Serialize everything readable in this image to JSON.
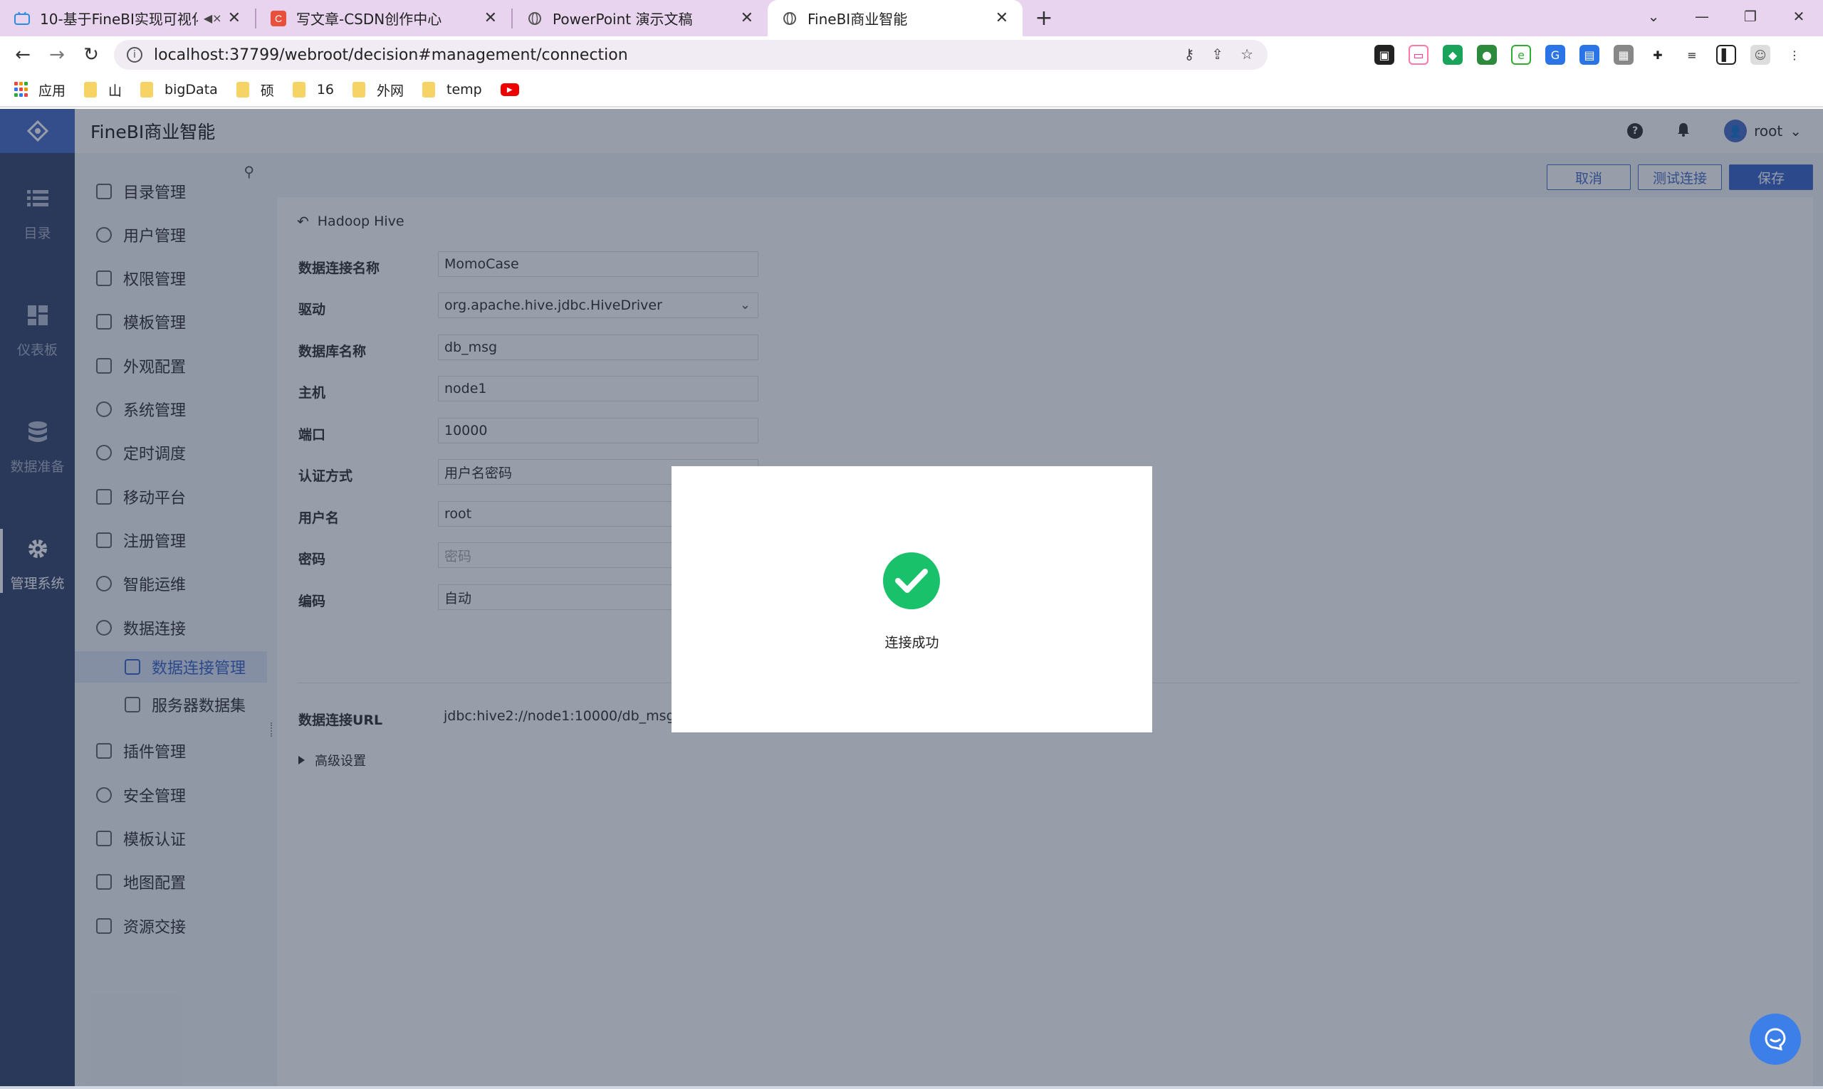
{
  "browser": {
    "tabs": [
      {
        "title": "10-基于FineBI实现可视化报",
        "icon": "bilibili-icon",
        "muted": true,
        "active": false
      },
      {
        "title": "写文章-CSDN创作中心",
        "icon": "csdn-icon",
        "active": false
      },
      {
        "title": "PowerPoint 演示文稿",
        "icon": "globe-icon",
        "active": false
      },
      {
        "title": "FineBI商业智能",
        "icon": "globe-icon",
        "active": true
      }
    ],
    "url": "localhost:37799/webroot/decision#management/connection",
    "bookmarks": [
      {
        "label": "应用",
        "type": "apps"
      },
      {
        "label": "山",
        "type": "folder"
      },
      {
        "label": "bigData",
        "type": "folder"
      },
      {
        "label": "硕",
        "type": "folder"
      },
      {
        "label": "16",
        "type": "folder"
      },
      {
        "label": "外网",
        "type": "folder"
      },
      {
        "label": "temp",
        "type": "folder"
      },
      {
        "label": "",
        "type": "youtube"
      }
    ]
  },
  "app": {
    "title": "FineBI商业智能",
    "user": "root",
    "rail": [
      {
        "label": "目录",
        "icon": "list-icon"
      },
      {
        "label": "仪表板",
        "icon": "dashboard-icon"
      },
      {
        "label": "数据准备",
        "icon": "database-icon"
      },
      {
        "label": "管理系统",
        "icon": "gear-icon",
        "active": true
      }
    ],
    "menu": [
      {
        "label": "目录管理"
      },
      {
        "label": "用户管理"
      },
      {
        "label": "权限管理"
      },
      {
        "label": "模板管理"
      },
      {
        "label": "外观配置"
      },
      {
        "label": "系统管理"
      },
      {
        "label": "定时调度"
      },
      {
        "label": "移动平台"
      },
      {
        "label": "注册管理"
      },
      {
        "label": "智能运维"
      },
      {
        "label": "数据连接"
      },
      {
        "label": "数据连接管理",
        "sub": true,
        "active": true
      },
      {
        "label": "服务器数据集",
        "sub": true
      },
      {
        "label": "插件管理"
      },
      {
        "label": "安全管理"
      },
      {
        "label": "模板认证"
      },
      {
        "label": "地图配置"
      },
      {
        "label": "资源交接"
      }
    ],
    "toolbar": {
      "cancel": "取消",
      "test": "测试连接",
      "save": "保存"
    },
    "connection": {
      "type": "Hadoop Hive",
      "fields": [
        {
          "label": "数据连接名称",
          "value": "MomoCase"
        },
        {
          "label": "驱动",
          "value": "org.apache.hive.jdbc.HiveDriver",
          "dropdown": true
        },
        {
          "label": "数据库名称",
          "value": "db_msg"
        },
        {
          "label": "主机",
          "value": "node1"
        },
        {
          "label": "端口",
          "value": "10000"
        },
        {
          "label": "认证方式",
          "value": "用户名密码"
        },
        {
          "label": "用户名",
          "value": "root"
        },
        {
          "label": "密码",
          "value": "",
          "placeholder": "密码"
        },
        {
          "label": "编码",
          "value": "自动"
        }
      ],
      "url_label": "数据连接URL",
      "url_value": "jdbc:hive2://node1:10000/db_msg",
      "advanced": "高级设置"
    },
    "dialog": {
      "message": "连接成功",
      "icon": "check-circle-icon",
      "color": "#19c26a"
    }
  }
}
